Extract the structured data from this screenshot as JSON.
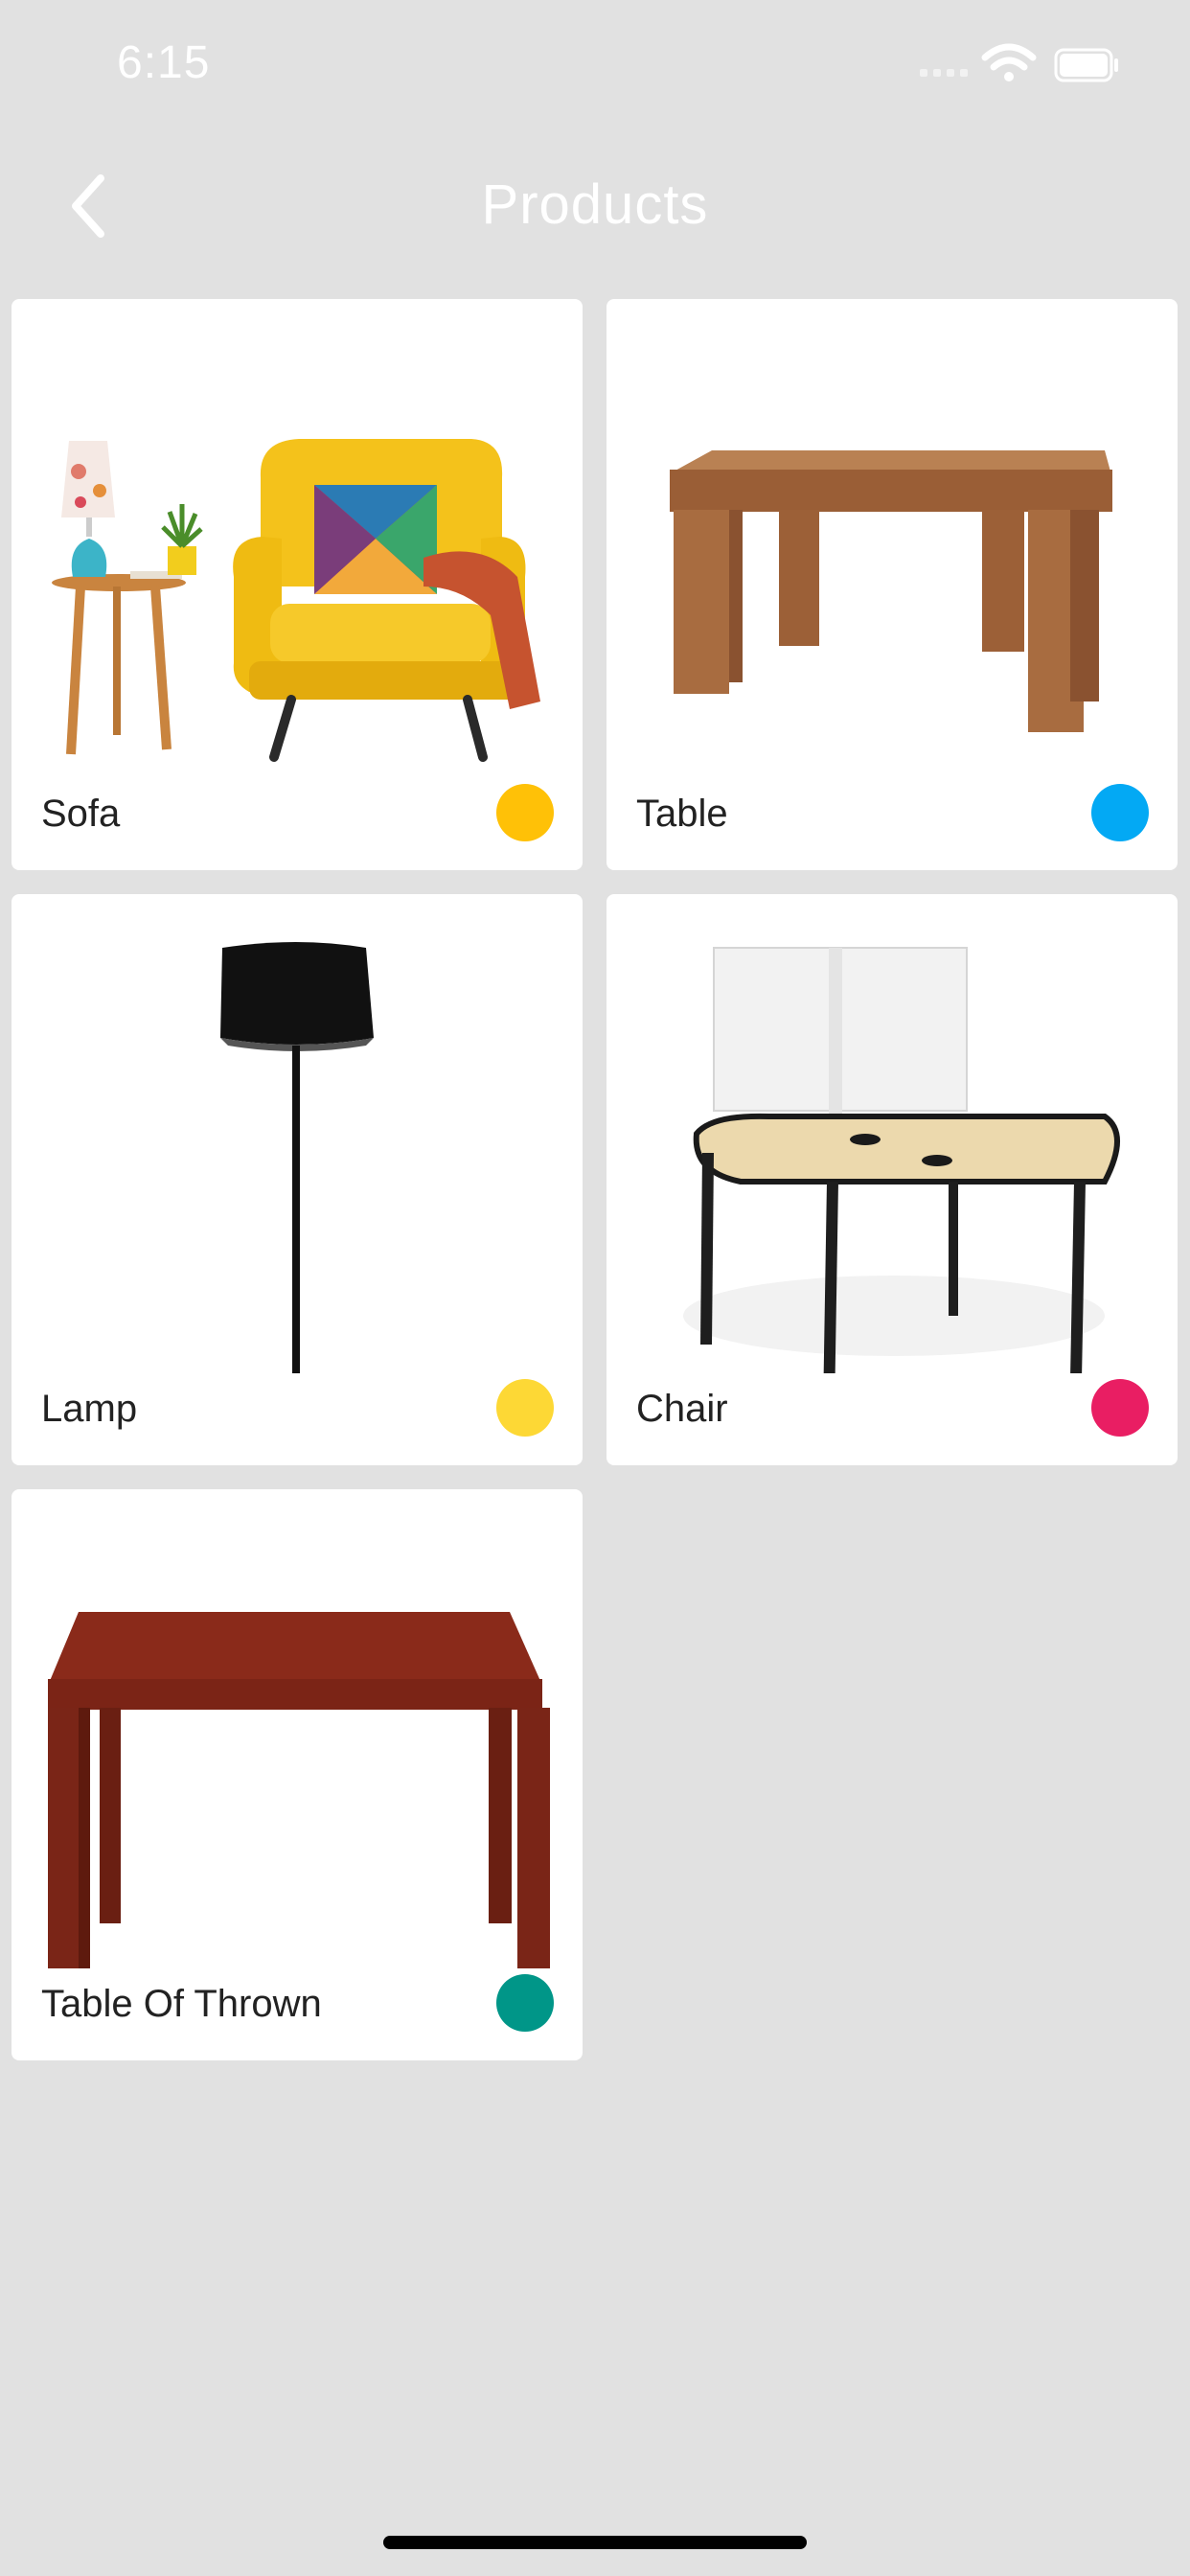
{
  "status_bar": {
    "time": "6:15",
    "icons": [
      "signal-icon",
      "wifi-icon",
      "battery-icon"
    ]
  },
  "nav": {
    "title": "Products",
    "back_icon": "chevron-left-icon"
  },
  "products": [
    {
      "label": "Sofa",
      "color": "#FFC107",
      "image": "armchair-with-side-table"
    },
    {
      "label": "Table",
      "color": "#03A9F4",
      "image": "wooden-coffee-table"
    },
    {
      "label": "Lamp",
      "color": "#FDD835",
      "image": "black-floor-lamp"
    },
    {
      "label": "Chair",
      "color": "#E91E63",
      "image": "office-desk-with-screen"
    },
    {
      "label": "Table Of Thrown",
      "color": "#009688",
      "image": "mahogany-table"
    }
  ],
  "colors": {
    "background": "#E1E1E1",
    "card": "#FFFFFF",
    "title": "#FFFFFF"
  }
}
